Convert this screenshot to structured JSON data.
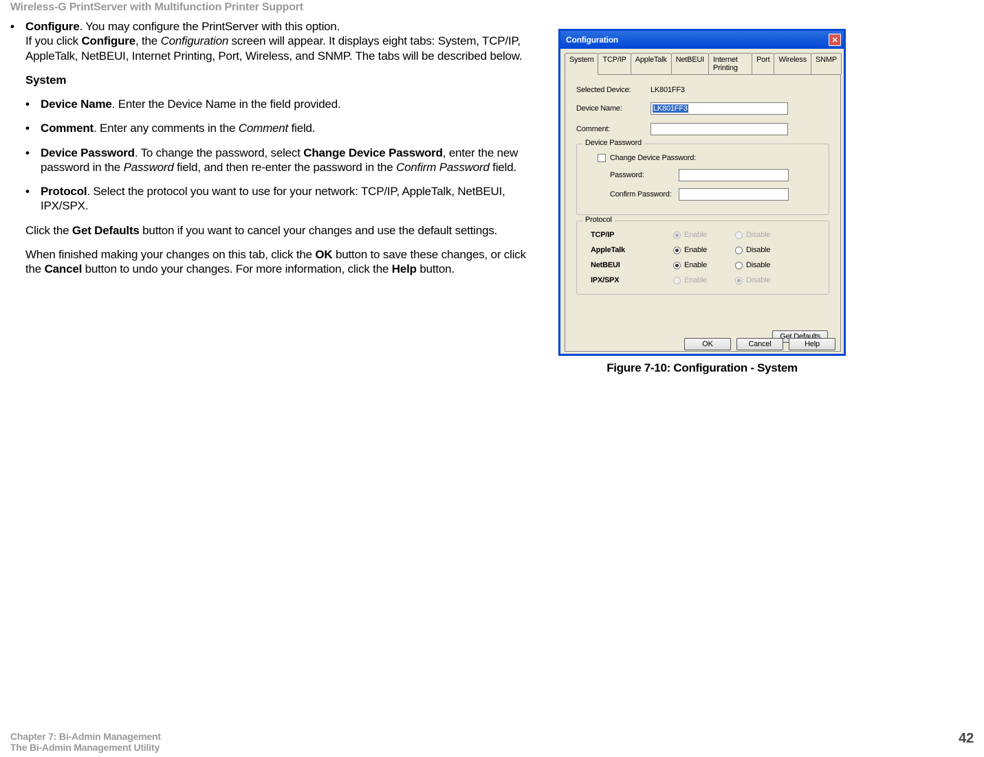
{
  "doc_header": "Wireless-G PrintServer with Multifunction Printer Support",
  "section": {
    "configure_bold": "Configure",
    "configure_rest": ". You may configure the PrintServer with this option.",
    "para1_a": "If you click ",
    "para1_b": "Configure",
    "para1_c": ", the ",
    "para1_d": "Configuration",
    "para1_e": " screen will appear. It displays eight tabs: System, TCP/IP, AppleTalk, NetBEUI, Internet Printing, Port, Wireless, and SNMP. The tabs will be described below.",
    "system_heading": "System",
    "li_devname_b": "Device Name",
    "li_devname_t": ". Enter the Device Name in the field provided.",
    "li_comment_b": "Comment",
    "li_comment_t1": ". Enter any comments in the ",
    "li_comment_i": "Comment",
    "li_comment_t2": " field.",
    "li_devpw_b": "Device Password",
    "li_devpw_t1": ". To change the password, select ",
    "li_devpw_b2": "Change Device Password",
    "li_devpw_t2": ", enter the new password in the ",
    "li_devpw_i1": "Password",
    "li_devpw_t3": " field, and then re-enter the password in the ",
    "li_devpw_i2": "Confirm Password",
    "li_devpw_t4": " field.",
    "li_proto_b": "Protocol",
    "li_proto_t": ". Select the protocol you want to use for your network: TCP/IP, AppleTalk, NetBEUI, IPX/SPX.",
    "para2_a": "Click the ",
    "para2_b": "Get Defaults",
    "para2_c": " button if you want to cancel your changes and use the default settings.",
    "para3_a": "When finished making your changes on this tab, click the ",
    "para3_b": "OK",
    "para3_c": " button to save these changes, or click the ",
    "para3_d": "Cancel",
    "para3_e": " button to undo your changes. For more information, click the ",
    "para3_f": "Help",
    "para3_g": " button."
  },
  "dialog": {
    "title": "Configuration",
    "tabs": [
      "System",
      "TCP/IP",
      "AppleTalk",
      "NetBEUI",
      "Internet Printing",
      "Port",
      "Wireless",
      "SNMP"
    ],
    "selected_device_label": "Selected Device:",
    "selected_device_value": "LK801FF3",
    "device_name_label": "Device Name:",
    "device_name_value": "LK801FF3",
    "comment_label": "Comment:",
    "group_password_title": "Device Password",
    "change_pw_label": "Change Device Password:",
    "password_label": "Password:",
    "confirm_password_label": "Confirm Password:",
    "group_protocol_title": "Protocol",
    "protocols": [
      {
        "name": "TCP/IP",
        "enabled": true,
        "disabled_ui": true
      },
      {
        "name": "AppleTalk",
        "enabled": true,
        "disabled_ui": false
      },
      {
        "name": "NetBEUI",
        "enabled": true,
        "disabled_ui": false
      },
      {
        "name": "IPX/SPX",
        "enabled": false,
        "disabled_ui": true
      }
    ],
    "enable_label": "Enable",
    "disable_label": "Disable",
    "get_defaults": "Get Defaults",
    "ok": "OK",
    "cancel": "Cancel",
    "help": "Help"
  },
  "figure_caption": "Figure 7-10: Configuration - System",
  "footer": {
    "chapter": "Chapter 7: Bi-Admin Management",
    "sub": "The Bi-Admin Management Utility",
    "page": "42"
  }
}
